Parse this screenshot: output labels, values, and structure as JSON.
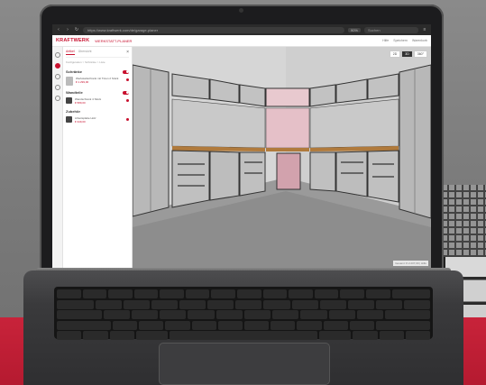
{
  "browser": {
    "url": "https://www.kraftwerk.com/de/garage-planer",
    "zoom": "90%",
    "search_placeholder": "Suchen"
  },
  "app": {
    "logo": "KRAFTWERK",
    "subtitle": "WERKSTATT-PLANER",
    "header_right": [
      "Hilfe",
      "Speichern",
      "Warenkorb"
    ]
  },
  "panel": {
    "tabs": [
      "Artikel",
      "Übersicht"
    ],
    "close_icon": "close-icon",
    "breadcrumb": "Konfiguration > Schränke > Liste",
    "sections": [
      {
        "title": "Schränke",
        "items": [
          {
            "text": "Werkstattschrank mit Türen 2 Stück",
            "price": "€ 1.299,00"
          }
        ]
      },
      {
        "title": "Wandteile",
        "items": [
          {
            "text": "Wandschrank 4 Stück",
            "price": "€ 589,00"
          }
        ]
      },
      {
        "title": "Zubehör",
        "items": [
          {
            "text": "Arbeitsplatte Holz",
            "price": "€ 349,00"
          }
        ]
      }
    ]
  },
  "viewport": {
    "view_modes": [
      "2D",
      "3D",
      "360°"
    ],
    "status": "Gesamt: € 2.237,00  |  Hilfe"
  },
  "colors": {
    "brand": "#c8102e",
    "backdrop_red": "#b51a30"
  }
}
